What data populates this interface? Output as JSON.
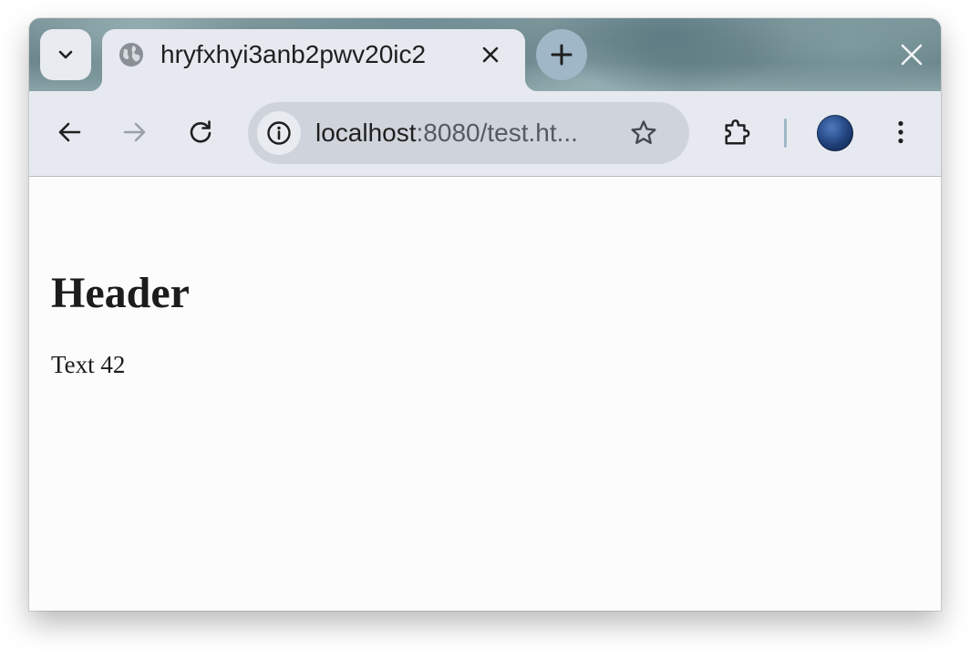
{
  "browser": {
    "tab": {
      "title": "hryfxhyi3anb2pwv20ic2"
    },
    "address_bar": {
      "url_host": "localhost",
      "url_rest": ":8080/test.ht..."
    },
    "icons": {
      "tab_dropdown": "chevron-down-icon",
      "favicon": "globe-icon",
      "tab_close": "close-icon",
      "new_tab": "plus-icon",
      "window_close": "close-icon",
      "back": "arrow-left-icon",
      "forward": "arrow-right-icon",
      "reload": "reload-icon",
      "site_info": "info-icon",
      "bookmark": "star-icon",
      "extensions": "puzzle-icon",
      "profile": "avatar",
      "menu": "more-vertical-icon"
    },
    "colors": {
      "tab_bg": "#e6eaf0",
      "toolbar_bg": "#e6eaf0",
      "omnibox_bg": "#cfd4dc",
      "new_tab_bg": "#9fb7c7",
      "forward_disabled": "#9aa0a6"
    }
  },
  "page": {
    "heading": "Header",
    "paragraph": "Text 42"
  }
}
